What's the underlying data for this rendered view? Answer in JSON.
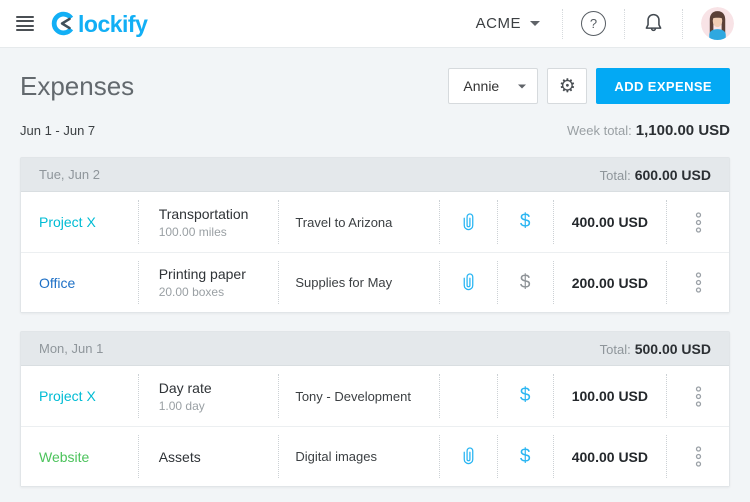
{
  "topbar": {
    "brand_rest": "lockify",
    "workspace": "ACME",
    "help_label": "?"
  },
  "page": {
    "title": "Expenses",
    "assignee_filter": "Annie",
    "add_expense_label": "ADD EXPENSE"
  },
  "week": {
    "range": "Jun 1 - Jun 7",
    "total_label": "Week total:",
    "total_value": "1,100.00 USD"
  },
  "colors": {
    "accent": "#03A9F4",
    "billable": "#29B5F2",
    "non_billable": "#8D9296"
  },
  "groups": [
    {
      "date": "Tue, Jun 2",
      "total_label": "Total:",
      "total_value": "600.00 USD",
      "rows": [
        {
          "project": "Project X",
          "project_color": "#00BCD4",
          "item": "Transportation",
          "quantity": "100.00 miles",
          "description": "Travel to Arizona",
          "attachment": true,
          "billable": true,
          "amount": "400.00 USD"
        },
        {
          "project": "Office",
          "project_color": "#1E70C6",
          "item": "Printing paper",
          "quantity": "20.00 boxes",
          "description": "Supplies for May",
          "attachment": true,
          "billable": false,
          "amount": "200.00 USD"
        }
      ]
    },
    {
      "date": "Mon, Jun 1",
      "total_label": "Total:",
      "total_value": "500.00 USD",
      "rows": [
        {
          "project": "Project X",
          "project_color": "#00BCD4",
          "item": "Day rate",
          "quantity": "1.00 day",
          "description": "Tony - Development",
          "attachment": false,
          "billable": true,
          "amount": "100.00 USD"
        },
        {
          "project": "Website",
          "project_color": "#4CC35C",
          "item": "Assets",
          "quantity": "",
          "description": "Digital images",
          "attachment": true,
          "billable": true,
          "amount": "400.00 USD"
        }
      ]
    }
  ]
}
